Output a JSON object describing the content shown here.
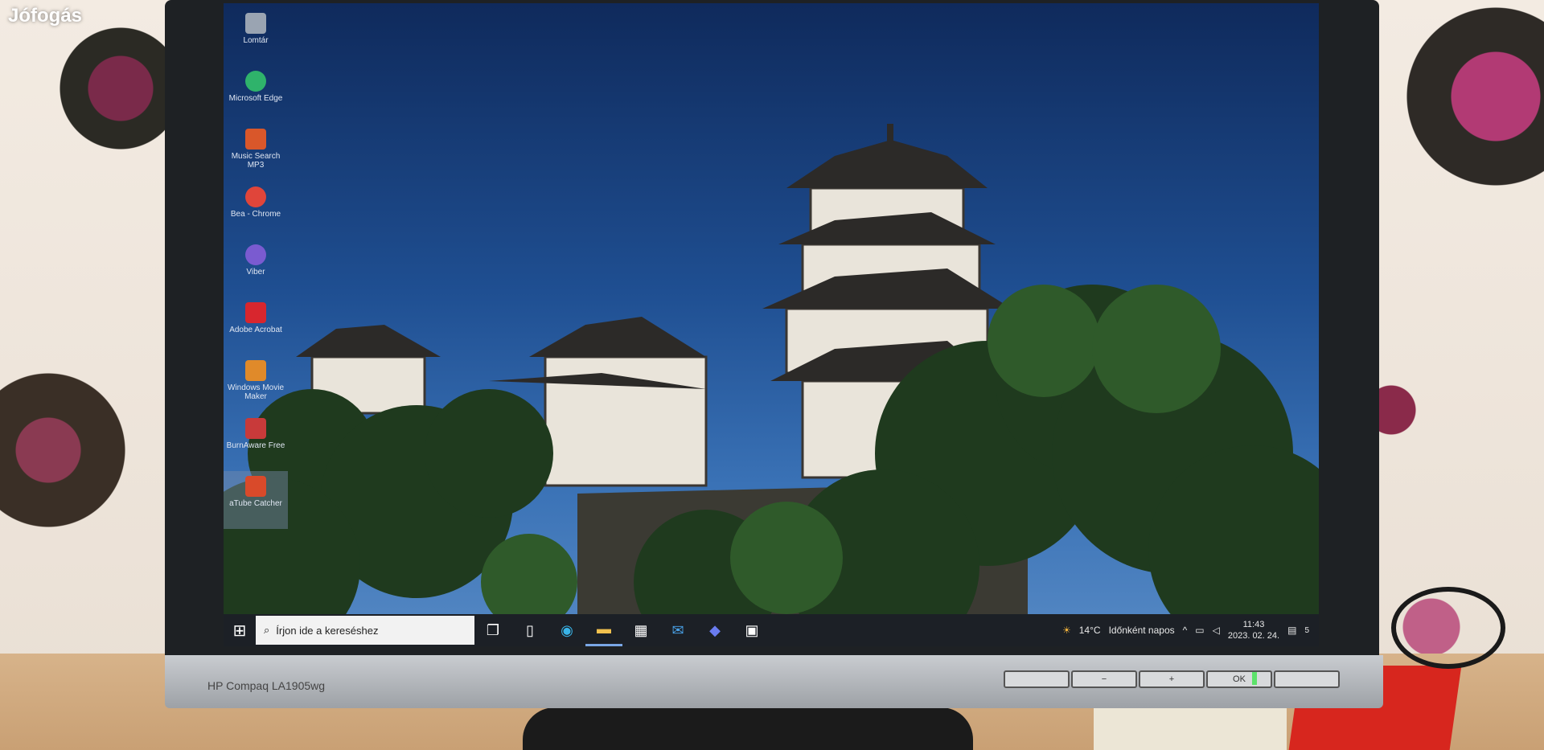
{
  "watermark": "Jófogás",
  "monitor": {
    "brand": "HP Compaq LA1905wg",
    "buttons": [
      "",
      "−",
      "+",
      "OK",
      ""
    ]
  },
  "desktop_icons": [
    {
      "label": "Lomtár",
      "icon": "recycle-bin-icon",
      "color": "#9aa4b2"
    },
    {
      "label": "Microsoft Edge",
      "icon": "edge-icon",
      "color": "#2fb36b"
    },
    {
      "label": "Music Search MP3",
      "icon": "music-search-icon",
      "color": "#d9572a"
    },
    {
      "label": "Bea - Chrome",
      "icon": "chrome-icon",
      "color": "#e0453a"
    },
    {
      "label": "Viber",
      "icon": "viber-icon",
      "color": "#7a5bd0"
    },
    {
      "label": "Adobe Acrobat",
      "icon": "acrobat-icon",
      "color": "#d8262e"
    },
    {
      "label": "Windows Movie Maker",
      "icon": "movie-maker-icon",
      "color": "#e08a2a"
    },
    {
      "label": "BurnAware Free",
      "icon": "burnaware-icon",
      "color": "#c83a3a"
    },
    {
      "label": "aTube Catcher",
      "icon": "atube-catcher-icon",
      "color": "#d94a2a"
    }
  ],
  "taskbar": {
    "search_placeholder": "Írjon ide a kereséshez",
    "weather_temp": "14°C",
    "weather_text": "Időnként napos",
    "time": "11:43",
    "date": "2023. 02. 24.",
    "notification_count": "5"
  }
}
